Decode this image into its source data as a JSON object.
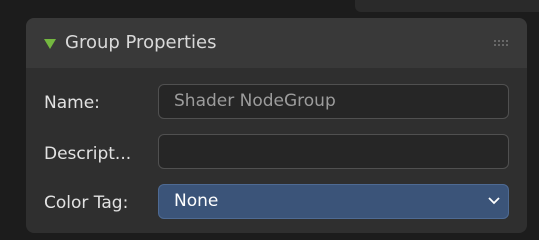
{
  "panel": {
    "title": "Group Properties",
    "collapse_icon": "triangle-down-icon",
    "drag_icon": "drag-grip-icon",
    "accent_color": "#74b840"
  },
  "fields": {
    "name": {
      "label": "Name:",
      "value": "Shader NodeGroup"
    },
    "description": {
      "label": "Descript...",
      "value": ""
    },
    "color_tag": {
      "label": "Color Tag:",
      "value": "None",
      "icon": "chevron-down-icon",
      "highlight_color": "#3b5479"
    }
  }
}
